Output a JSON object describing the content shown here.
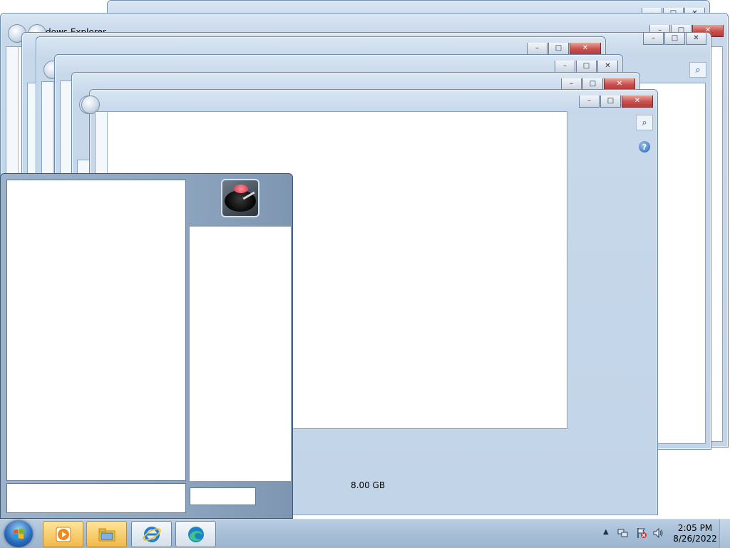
{
  "windows": {
    "explorer_title": "dows Explorer",
    "min_glyph": "–",
    "max_glyph": "□",
    "close_glyph": "✕",
    "search_glyph": "⌕",
    "help_glyph": "?"
  },
  "content": {
    "memory_value": "8.00 GB"
  },
  "start_menu": {
    "search_placeholder": "",
    "shutdown_label": ""
  },
  "taskbar": {
    "pinned": [
      {
        "name": "Windows Media Player",
        "icon": "media-player-icon"
      },
      {
        "name": "Windows Explorer",
        "icon": "folder-icon"
      },
      {
        "name": "Internet Explorer",
        "icon": "ie-icon"
      },
      {
        "name": "Microsoft Edge",
        "icon": "edge-icon"
      }
    ],
    "tray_arrow": "▲",
    "time": "2:05 PM",
    "date": "8/26/2022"
  },
  "colors": {
    "taskbar": "#a9c0d8",
    "close_button": "#c75050",
    "start_menu": "#8ea5bf"
  }
}
